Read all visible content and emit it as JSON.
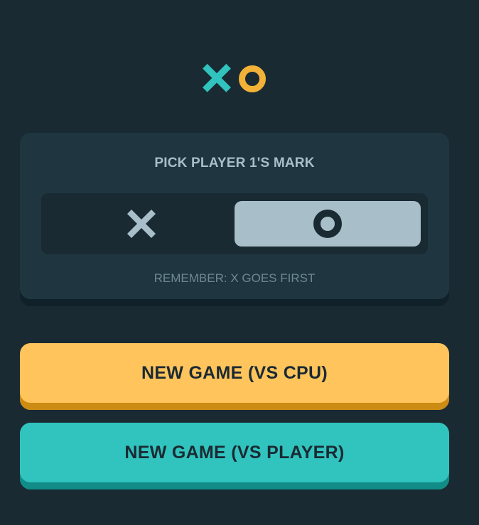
{
  "logo": {
    "x_icon": "x-mark-icon",
    "o_icon": "o-mark-icon",
    "x_color": "#31c3bd",
    "o_color": "#f2b137"
  },
  "mark_picker": {
    "title": "PICK PLAYER 1'S MARK",
    "options": [
      {
        "mark": "X",
        "icon": "x-mark-icon",
        "selected": false
      },
      {
        "mark": "O",
        "icon": "o-mark-icon",
        "selected": true
      }
    ],
    "hint": "REMEMBER: X GOES FIRST"
  },
  "buttons": {
    "vs_cpu": "NEW GAME (VS CPU)",
    "vs_player": "NEW GAME (VS PLAYER)"
  },
  "colors": {
    "background": "#1a2a33",
    "card": "#1f3641",
    "silver": "#a8bfc9",
    "yellow": "#ffc45c",
    "teal": "#31c4be"
  }
}
